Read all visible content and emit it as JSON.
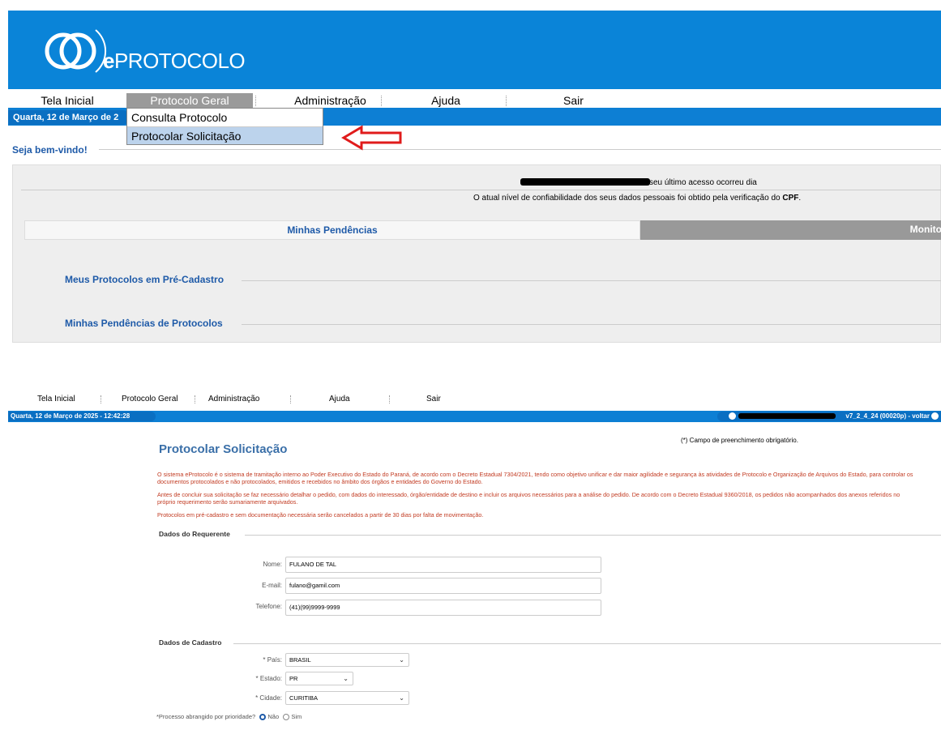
{
  "top": {
    "app_name_bold": "e",
    "app_name_rest": "PROTOCOLO",
    "menu": {
      "tela_inicial": "Tela Inicial",
      "protocolo_geral": "Protocolo Geral",
      "administracao": "Administração",
      "ajuda": "Ajuda",
      "sair": "Sair"
    },
    "date": "Quarta, 12 de Março de 2",
    "dropdown": {
      "item1": "Consulta Protocolo",
      "item2": "Protocolar Solicitação"
    },
    "welcome": "Seja bem-vindo!",
    "last_access": "seu último acesso ocorreu dia",
    "trust_text": "O atual nível de confiabilidade dos seus dados pessoais foi obtido pela verificação do",
    "trust_bold": "CPF",
    "trust_end": ".",
    "tab_pendencias": "Minhas Pendências",
    "tab_monitor": "Monito",
    "sec_precadastro": "Meus Protocolos em Pré-Cadastro",
    "sec_pendencias": "Minhas Pendências de Protocolos"
  },
  "bottom": {
    "menu": {
      "tela_inicial": "Tela Inicial",
      "protocolo_geral": "Protocolo Geral",
      "administracao": "Administração",
      "ajuda": "Ajuda",
      "sair": "Sair"
    },
    "date": "Quarta, 12 de Março de 2025 - 12:42:28",
    "version": "v7_2_4_24 (00020p) - voltar",
    "required_note": "(*) Campo de preenchimento obrigatório.",
    "title": "Protocolar Solicitação",
    "desc1": "O sistema eProtocolo é o sistema de tramitação interno ao Poder Executivo do Estado do Paraná, de acordo com o Decreto Estadual 7304/2021, tendo como objetivo unificar e dar maior agilidade e segurança às atividades de Protocolo e Organização de Arquivos do Estado, para controlar os documentos protocolados e não protocolados, emitidos e recebidos no âmbito dos órgãos e entidades do Governo do Estado.",
    "desc2": "Antes de concluir sua solicitação se faz necessário detalhar o pedido, com dados do interessado, órgão/entidade de destino e incluir os arquivos necessários para a análise do pedido. De acordo com o Decreto Estadual 9360/2018, os pedidos não acompanhados dos anexos referidos no próprio requerimento serão sumariamente arquivados.",
    "desc3": "Protocolos em pré-cadastro e sem documentação necessária serão cancelados a partir de 30 dias por falta de movimentação.",
    "section_requerente": "Dados do Requerente",
    "nome_label": "Nome:",
    "nome_value": "FULANO DE TAL",
    "email_label": "E-mail:",
    "email_value": "fulano@gamil.com",
    "telefone_label": "Telefone:",
    "telefone_value": "(41)(99)9999-9999",
    "section_cadastro": "Dados de Cadastro",
    "pais_label": "País:",
    "pais_value": "BRASIL",
    "estado_label": "Estado:",
    "estado_value": "PR",
    "cidade_label": "Cidade:",
    "cidade_value": "CURITIBA",
    "asterisk": "*",
    "prioridade_label": "*Processo abrangido por prioridade?",
    "opt_nao": "Não",
    "opt_sim": "Sim"
  }
}
